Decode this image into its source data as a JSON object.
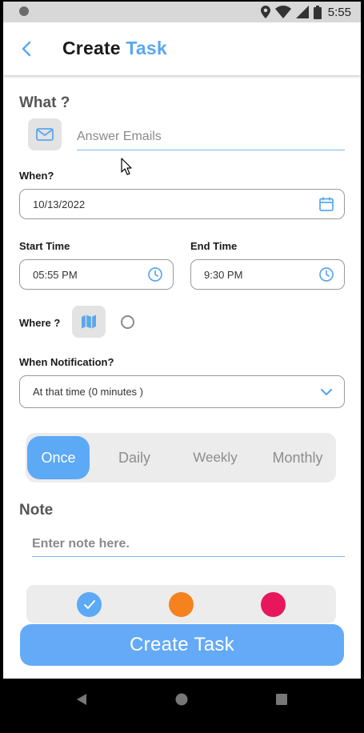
{
  "status_bar": {
    "time": "5:55",
    "icons": [
      "location-icon",
      "wifi-icon",
      "signal-icon",
      "battery-icon"
    ]
  },
  "header": {
    "title_main": "Create",
    "title_accent": "Task",
    "back_icon": "back-chevron-icon"
  },
  "what": {
    "label": "What ?",
    "icon": "mail-icon",
    "placeholder": "Answer Emails",
    "value": ""
  },
  "when": {
    "label": "When?",
    "date": "10/13/2022",
    "icon": "calendar-icon"
  },
  "start_time": {
    "label": "Start Time",
    "value": "05:55 PM",
    "icon": "clock-icon"
  },
  "end_time": {
    "label": "End Time",
    "value": "9:30 PM",
    "icon": "clock-icon"
  },
  "where": {
    "label": "Where ?",
    "icon": "map-icon"
  },
  "notification": {
    "label": "When Notification?",
    "selected": "At that time (0 minutes )",
    "icon": "chevron-down-icon"
  },
  "repeat": {
    "options": [
      "Once",
      "Daily",
      "Weekly",
      "Monthly"
    ],
    "selected": "Once"
  },
  "note": {
    "label": "Note",
    "placeholder": "Enter note here.",
    "value": ""
  },
  "colors": {
    "swatches": [
      "#5ca9f5",
      "#f5821f",
      "#e8175d"
    ],
    "selected_index": 0
  },
  "create_button": {
    "label": "Create Task"
  },
  "theme": {
    "accent": "#5aa7ef",
    "button": "#64aaf6"
  }
}
